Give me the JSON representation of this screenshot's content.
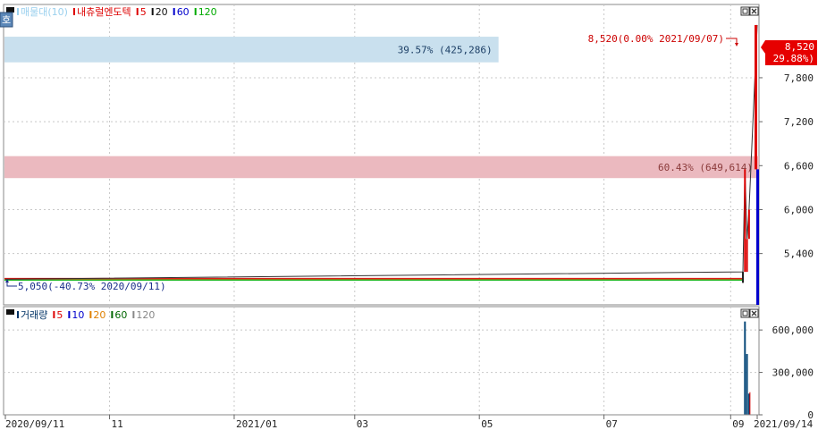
{
  "legend_price": [
    {
      "text": "매물대(10)",
      "color": "#9ad0ee"
    },
    {
      "text": "내츄럴엔도텍",
      "color": "#dd0000"
    },
    {
      "text": "5",
      "color": "#dd0000"
    },
    {
      "text": "20",
      "color": "#111111"
    },
    {
      "text": "60",
      "color": "#0000cc"
    },
    {
      "text": "120",
      "color": "#00aa00"
    }
  ],
  "legend_volume": [
    {
      "text": "거래량",
      "color": "#003366"
    },
    {
      "text": "5",
      "color": "#dd0000"
    },
    {
      "text": "10",
      "color": "#0000cc"
    },
    {
      "text": "20",
      "color": "#e08000"
    },
    {
      "text": "60",
      "color": "#006600"
    },
    {
      "text": "120",
      "color": "#888888"
    }
  ],
  "side_icon_label": "호",
  "chart_data": [
    {
      "type": "line",
      "title": "내츄럴엔도텍",
      "y_ticks": [
        5400,
        6000,
        6600,
        7200,
        7800
      ],
      "y_tick_labels": [
        "5,400",
        "6,000",
        "6,600",
        "7,200",
        "7,800"
      ],
      "ylim": [
        4700,
        8800
      ],
      "x_tick_labels": [
        "2020/09/11",
        "11",
        "2021/01",
        "03",
        "05",
        "07",
        "09",
        "2021/09/14"
      ],
      "volume_profile": [
        {
          "price_low": 8010,
          "price_high": 8360,
          "pct": 39.57,
          "volume": 425286,
          "label": "39.57% (425,286)"
        },
        {
          "price_low": 6430,
          "price_high": 6730,
          "pct": 60.43,
          "volume": 649614,
          "label": "60.43% (649,614)"
        }
      ],
      "flat_price": 5050,
      "series": [
        {
          "name": "내츄럴엔도텍",
          "points": [
            {
              "x": "2020/09/11",
              "y": 5050
            },
            {
              "x": "2021/09/07",
              "y": 5150
            },
            {
              "x": "2021/09/08",
              "y": 6550
            },
            {
              "x": "2021/09/09",
              "y": 5600
            },
            {
              "x": "2021/09/10",
              "y": 6000
            },
            {
              "x": "2021/09/14",
              "y": 8520
            }
          ]
        }
      ],
      "annotations": {
        "max_label": "8,520(0.00% 2021/09/07)",
        "min_label": "5,050(-40.73% 2020/09/11)",
        "last_price": "8,520",
        "last_change": "( 29.88%)"
      },
      "grid": true
    },
    {
      "type": "bar",
      "title": "거래량",
      "y_ticks": [
        0,
        300000,
        600000
      ],
      "y_tick_labels": [
        "0",
        "300,000",
        "600,000"
      ],
      "ylim": [
        0,
        740000
      ],
      "bars": [
        {
          "x": "2021/09/08",
          "value": 660000
        },
        {
          "x": "2021/09/09",
          "value": 430000
        },
        {
          "x": "2021/09/10",
          "value": 150000
        }
      ]
    }
  ]
}
